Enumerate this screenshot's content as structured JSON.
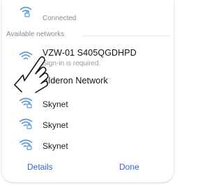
{
  "connected_network": {
    "status": "Connected",
    "icon": "wifi-lock-icon"
  },
  "available_label": "Available networks",
  "networks": [
    {
      "name": "VZW-01 S405QGDHPD",
      "subtitle": "Sign-in is required.",
      "icon": "wifi-lock-icon"
    },
    {
      "name": "Alderon Network",
      "subtitle": "",
      "icon": "wifi-lock-icon"
    },
    {
      "name": "Skynet",
      "subtitle": "",
      "icon": "wifi-lock-icon"
    },
    {
      "name": "Skynet",
      "subtitle": "",
      "icon": "wifi-lock-icon"
    },
    {
      "name": "Skynet",
      "subtitle": "",
      "icon": "wifi-lock-icon"
    }
  ],
  "buttons": {
    "details": "Details",
    "done": "Done"
  },
  "colors": {
    "accent": "#3366c8",
    "wifi_icon": "#5b9bd5"
  }
}
